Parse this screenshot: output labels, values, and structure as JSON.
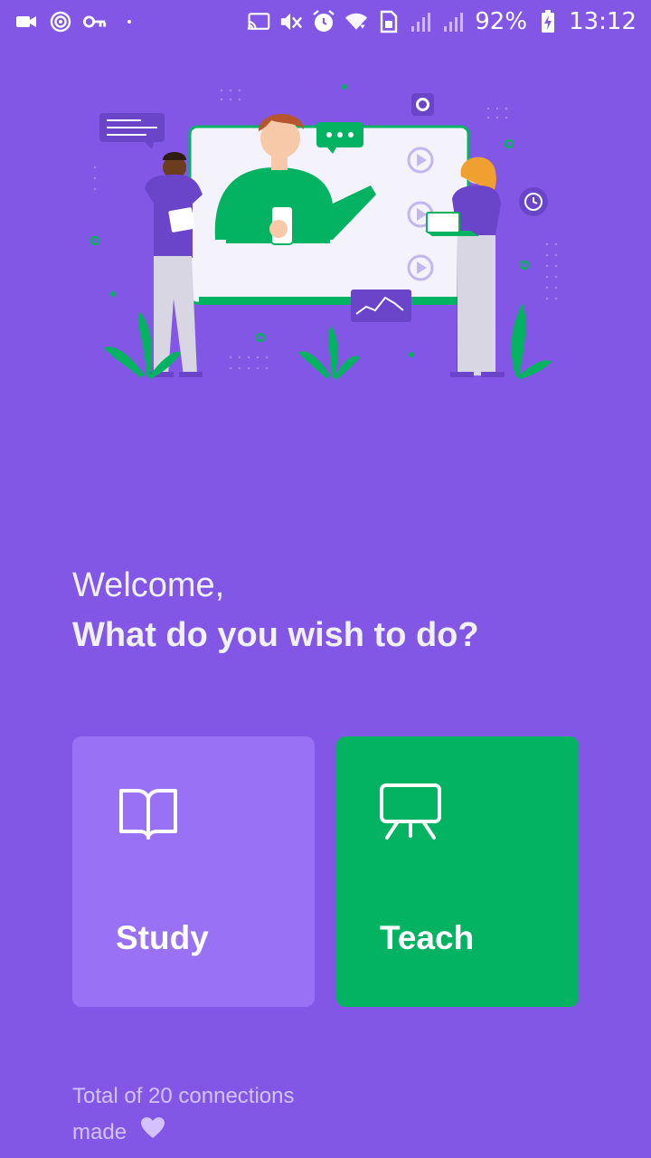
{
  "status_bar": {
    "battery": "92%",
    "time": "13:12",
    "icons_left": [
      "video-camera-icon",
      "hotspot-icon",
      "vpn-key-icon",
      "dot-icon"
    ],
    "icons_right": [
      "cast-icon",
      "mute-icon",
      "alarm-icon",
      "wifi-icon",
      "sim-icon",
      "signal-icon",
      "signal-icon",
      "battery-charging-icon"
    ]
  },
  "hero": {
    "illustration": "online-teaching-illustration"
  },
  "greeting": {
    "welcome": "Welcome,",
    "question": "What do you wish to do?"
  },
  "actions": {
    "study": {
      "label": "Study",
      "icon": "book-open-icon",
      "color": "#9871f5"
    },
    "teach": {
      "label": "Teach",
      "icon": "presentation-board-icon",
      "color": "#04b361"
    }
  },
  "footer": {
    "line1": "Total of 20 connections",
    "line2": "made",
    "icon": "heart-icon"
  },
  "colors": {
    "background": "#8257e5",
    "accent_green": "#04b361",
    "text_light": "#d4c2ff"
  }
}
